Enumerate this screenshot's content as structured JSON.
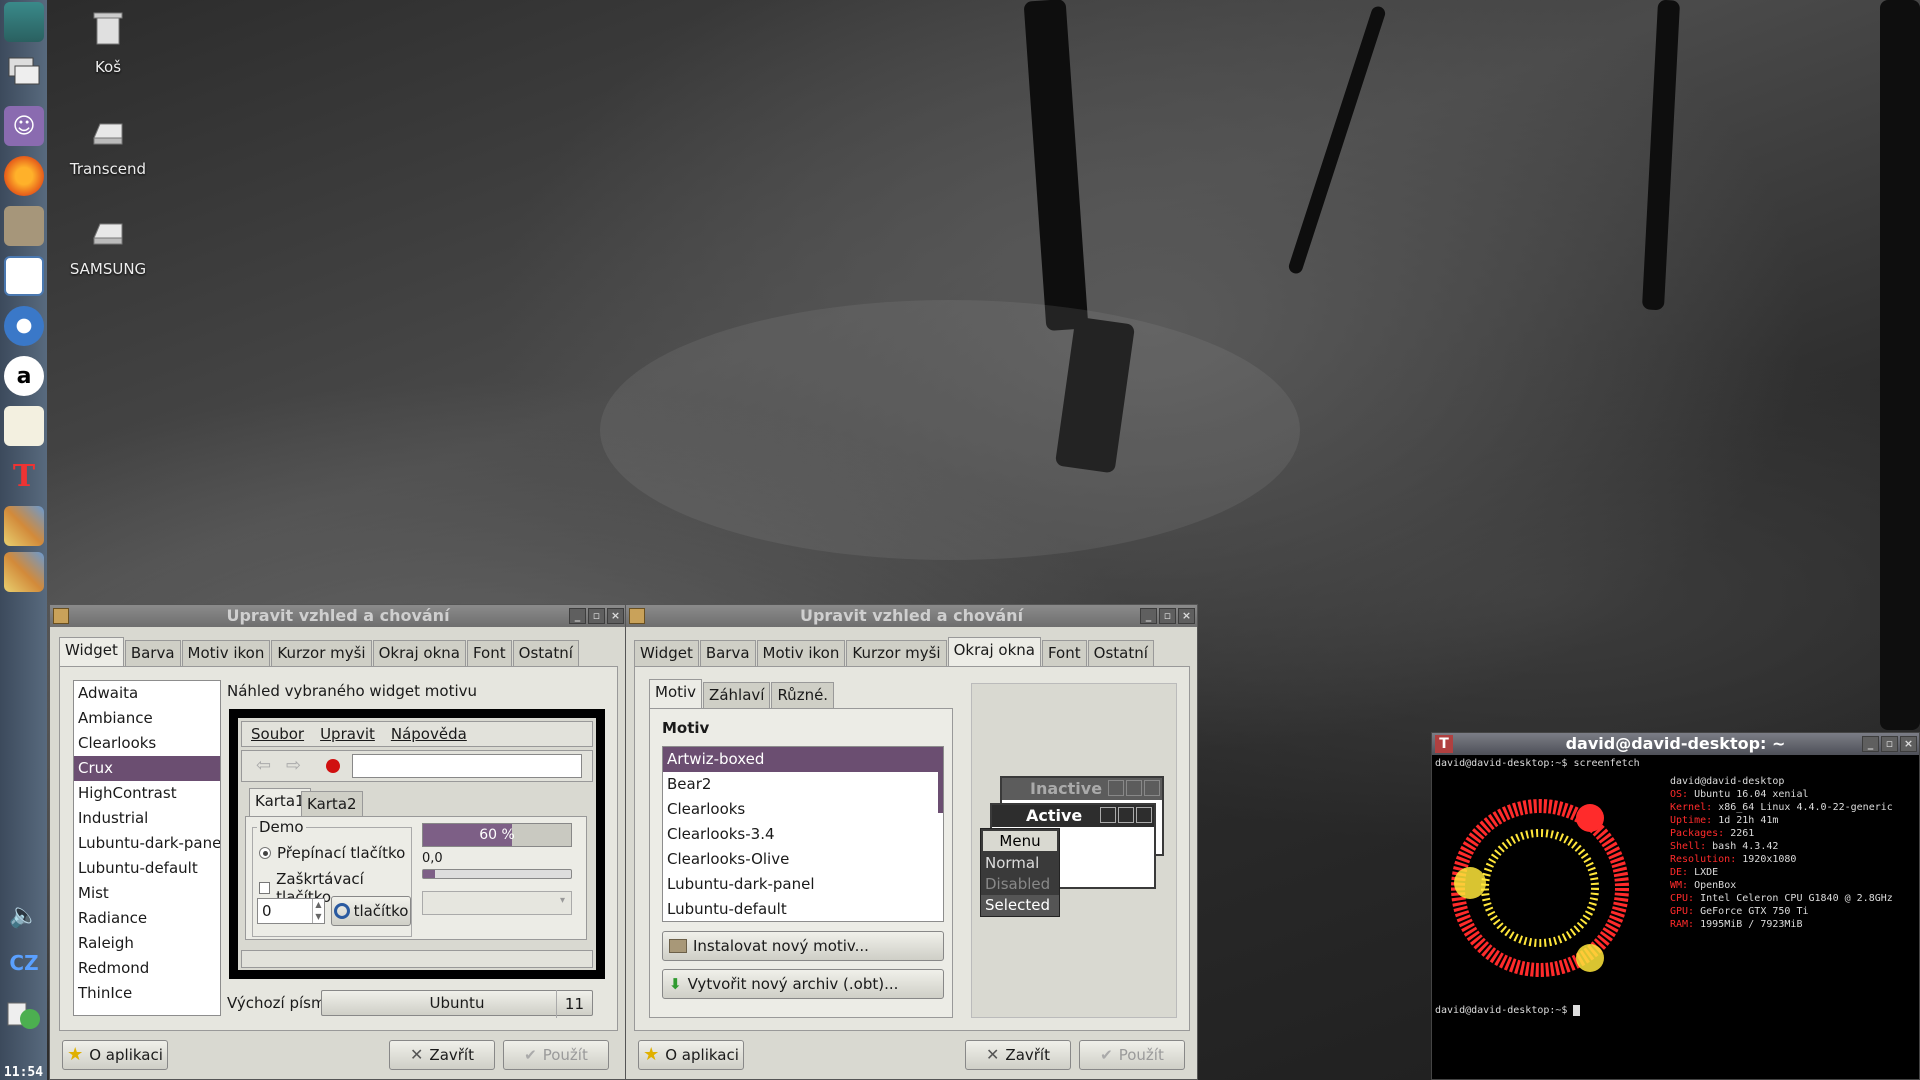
{
  "desktop": {
    "icons": [
      {
        "label": "Koš",
        "icon": "trash-icon"
      },
      {
        "label": "Transcend",
        "icon": "drive-icon"
      },
      {
        "label": "SAMSUNG",
        "icon": "drive-icon"
      }
    ]
  },
  "dock": {
    "items": [
      "desktop-icon",
      "windows-icon",
      "pidgin-icon",
      "firefox-icon",
      "folder-icon",
      "window-icon",
      "chromium-icon",
      "amazon-icon",
      "text-editor-icon",
      "texmaker-icon",
      "palette-icon",
      "palette-icon",
      "volume-icon",
      "keyboard-layout-icon",
      "network-icon"
    ],
    "keyboard_layout": "CZ",
    "clock": "11:54"
  },
  "window_left": {
    "title": "Upravit vzhled a chování",
    "tabs": [
      "Widget",
      "Barva",
      "Motiv ikon",
      "Kurzor myši",
      "Okraj okna",
      "Font",
      "Ostatní"
    ],
    "active_tab": "Widget",
    "themes": [
      "Adwaita",
      "Ambiance",
      "Clearlooks",
      "Crux",
      "HighContrast",
      "Industrial",
      "Lubuntu-dark-panel",
      "Lubuntu-default",
      "Mist",
      "Radiance",
      "Raleigh",
      "Redmond",
      "ThinIce"
    ],
    "selected_theme": "Crux",
    "preview_label": "Náhled vybraného widget motivu",
    "preview": {
      "menu": [
        "Soubor",
        "Upravit",
        "Nápověda"
      ],
      "tabs": [
        "Karta1",
        "Karta2"
      ],
      "demo_label": "Demo",
      "radio_label": "Přepínací tlačítko",
      "check_label": "Zaškrtávací tlačítko",
      "progress_text": "60 %",
      "progress_value": 0.6,
      "scale_value": "0,0",
      "spin_value": "0",
      "button_label": "tlačítko"
    },
    "default_font_label": "Výchozí písmo:",
    "default_font_name": "Ubuntu",
    "default_font_size": "11",
    "about_button": "O aplikaci",
    "close_button": "Zavřít",
    "apply_button": "Použít"
  },
  "window_right": {
    "title": "Upravit vzhled a chování",
    "tabs": [
      "Widget",
      "Barva",
      "Motiv ikon",
      "Kurzor myši",
      "Okraj okna",
      "Font",
      "Ostatní"
    ],
    "active_tab": "Okraj okna",
    "subtabs": [
      "Motiv",
      "Záhlaví",
      "Různé."
    ],
    "motiv_heading": "Motiv",
    "themes": [
      "Artwiz-boxed",
      "Bear2",
      "Clearlooks",
      "Clearlooks-3.4",
      "Clearlooks-Olive",
      "Lubuntu-dark-panel",
      "Lubuntu-default"
    ],
    "selected_theme": "Artwiz-boxed",
    "install_button": "Instalovat nový motiv...",
    "archive_button": "Vytvořit nový archiv (.obt)...",
    "preview": {
      "inactive_title": "Inactive",
      "active_title": "Active",
      "menu_items": [
        "Menu",
        "Normal",
        "Disabled",
        "Selected"
      ]
    },
    "about_button": "O aplikaci",
    "close_button": "Zavřít",
    "apply_button": "Použít"
  },
  "terminal": {
    "title": "david@david-desktop: ~",
    "prompt1": "david@david-desktop:~$ screenfetch",
    "user_host": "david@david-desktop",
    "info": [
      {
        "k": "OS:",
        "v": "Ubuntu 16.04 xenial"
      },
      {
        "k": "Kernel:",
        "v": "x86_64 Linux 4.4.0-22-generic"
      },
      {
        "k": "Uptime:",
        "v": "1d 21h 41m"
      },
      {
        "k": "Packages:",
        "v": "2261"
      },
      {
        "k": "Shell:",
        "v": "bash 4.3.42"
      },
      {
        "k": "Resolution:",
        "v": "1920x1080"
      },
      {
        "k": "DE:",
        "v": "LXDE"
      },
      {
        "k": "WM:",
        "v": "OpenBox"
      },
      {
        "k": "CPU:",
        "v": "Intel Celeron CPU G1840 @ 2.8GHz"
      },
      {
        "k": "GPU:",
        "v": "GeForce GTX 750 Ti"
      },
      {
        "k": "RAM:",
        "v": "1995MiB / 7923MiB"
      }
    ],
    "prompt2": "david@david-desktop:~$"
  },
  "colors": {
    "selection": "#6b4e71",
    "progress": "#7d5f86",
    "terminal_red": "#ff2b2b",
    "terminal_yellow": "#ffe63a"
  }
}
